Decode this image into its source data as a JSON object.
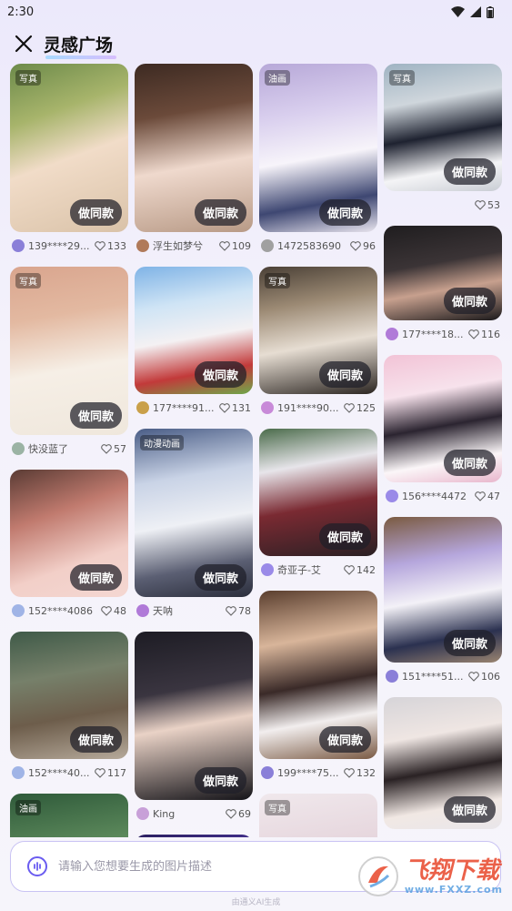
{
  "status": {
    "time": "2:30"
  },
  "header": {
    "title": "灵感广场"
  },
  "make_label": "做同款",
  "columns": [
    [
      {
        "tag": "写真",
        "user": "139****29...",
        "likes": "133",
        "h": 185,
        "bg": "linear-gradient(160deg,#6c8a4a 0%,#a7b46b 30%,#f1dcc8 55%,#d9c2a8 100%)",
        "av": "#8a7fd8"
      },
      {
        "tag": "写真",
        "user": "快没蓝了",
        "likes": "57",
        "h": 185,
        "bg": "linear-gradient(170deg,#d9a58e 0%,#e3b9a1 30%,#f6efe6 60%,#efe7dc 100%)",
        "av": "#9bb3a4"
      },
      {
        "tag": "",
        "user": "152****4086",
        "likes": "48",
        "h": 140,
        "bg": "linear-gradient(160deg,#5a3b34 0%,#c07a6e 35%,#f2cfc8 70%,#f4d7d2 100%)",
        "av": "#a0b4e6"
      },
      {
        "tag": "",
        "user": "152****40...",
        "likes": "117",
        "h": 140,
        "bg": "linear-gradient(170deg,#3f5a48 0%,#76806a 35%,#6d5d4b 65%,#b5a99a 100%)",
        "av": "#a0b4e6"
      },
      {
        "tag": "油画",
        "user": "",
        "likes": "",
        "h": 120,
        "bg": "linear-gradient(170deg,#2f5a3a 0%,#5d8a5c 50%,#9bbd86 100%)",
        "av": "#8a7fd8"
      }
    ],
    [
      {
        "tag": "",
        "user": "浮生如梦兮",
        "likes": "109",
        "h": 185,
        "bg": "linear-gradient(170deg,#3d2a22 0%,#6b4a3a 30%,#efd9cd 60%,#b89a86 100%)",
        "av": "#b07a5a"
      },
      {
        "tag": "",
        "user": "177****91...",
        "likes": "131",
        "h": 140,
        "bg": "linear-gradient(170deg,#7fb3e6 0%,#cfe4f5 30%,#f4f1f3 55%,#c23a3a 80%,#6fa84a 100%)",
        "av": "#c9a04a"
      },
      {
        "tag": "动漫动画",
        "user": "天呐",
        "likes": "78",
        "h": 185,
        "bg": "linear-gradient(170deg,#4a5d86 0%,#c9d3e6 30%,#eef0f5 55%,#5b5f73 80%,#2b2e3c 100%)",
        "av": "#b07ad8"
      },
      {
        "tag": "",
        "user": "King",
        "likes": "69",
        "h": 185,
        "bg": "linear-gradient(170deg,#1d1c24 0%,#3a3540 35%,#e9d2c6 55%,#141318 100%)",
        "av": "#c8a0d8"
      },
      {
        "tag": "",
        "user": "",
        "likes": "",
        "h": 120,
        "bg": "linear-gradient(170deg,#2a1f5e 0%,#6a4ad8 50%,#1a1540 100%)",
        "av": "#8a7fd8"
      }
    ],
    [
      {
        "tag": "油画",
        "user": "1472583690",
        "likes": "96",
        "h": 185,
        "bg": "linear-gradient(170deg,#b7a8d8 0%,#d9cfee 30%,#f7f4fa 55%,#3e4772 80%,#e9e5ef 100%)",
        "av": "#a0a0a0"
      },
      {
        "tag": "写真",
        "user": "191****90...",
        "likes": "125",
        "h": 140,
        "bg": "linear-gradient(170deg,#4a4036 0%,#9c8a74 30%,#e6ddd2 60%,#2b2521 100%)",
        "av": "#c88ad8"
      },
      {
        "tag": "",
        "user": "奇亚子-艾",
        "likes": "142",
        "h": 140,
        "bg": "linear-gradient(170deg,#4a6b4a 0%,#e7e5ea 30%,#7a2a32 60%,#2a2024 100%)",
        "av": "#9a8ae8"
      },
      {
        "tag": "",
        "user": "199****75...",
        "likes": "132",
        "h": 185,
        "bg": "linear-gradient(170deg,#5a3e2e 0%,#d8b59a 30%,#3a2a28 55%,#f2eeee 75%,#7a5a44 100%)",
        "av": "#8a7fd8"
      },
      {
        "tag": "写真",
        "user": "",
        "likes": "",
        "h": 120,
        "bg": "linear-gradient(170deg,#f0e8ec 0%,#e6d6dd 50%,#c9b0bb 100%)",
        "av": "#8a7fd8"
      }
    ],
    [
      {
        "tag": "写真",
        "user": "",
        "likes": "53",
        "h": 140,
        "bg": "linear-gradient(170deg,#9fb3c2 0%,#cfd6dc 30%,#1e2230 55%,#f4f4f6 80%,#c9cdd4 100%)",
        "av": ""
      },
      {
        "tag": "",
        "user": "177****18...",
        "likes": "116",
        "h": 104,
        "bg": "linear-gradient(170deg,#1f1d1f 0%,#3b3436 40%,#c7a08e 65%,#1a181a 100%)",
        "av": "#b07ad8"
      },
      {
        "tag": "",
        "user": "156****4472",
        "likes": "47",
        "h": 140,
        "bg": "linear-gradient(170deg,#f2c3d6 0%,#f7e2ec 30%,#2b2430 55%,#fbf6f8 80%,#e8b6cc 100%)",
        "av": "#9a8ae8"
      },
      {
        "tag": "",
        "user": "151****51...",
        "likes": "106",
        "h": 160,
        "bg": "linear-gradient(170deg,#7a5a40 0%,#b5a6dc 30%,#f3f1f7 55%,#2b3150 80%,#9a8470 100%)",
        "av": "#8a7fd8"
      },
      {
        "tag": "",
        "user": "",
        "likes": "",
        "h": 145,
        "bg": "linear-gradient(170deg,#d6d4d8 0%,#efe6e3 30%,#2a2224 55%,#f1e8e4 80%,#e9e6ea 100%)",
        "av": "#8a7fd8"
      }
    ]
  ],
  "input": {
    "placeholder": "请输入您想要生成的图片描述"
  },
  "footer": {
    "note": "由通义AI生成"
  },
  "watermark": {
    "name": "飞翔下载",
    "url": "www.FXXZ.com"
  },
  "colors": {
    "accent": "#6a5cf0",
    "border": "#c9c3f3"
  }
}
